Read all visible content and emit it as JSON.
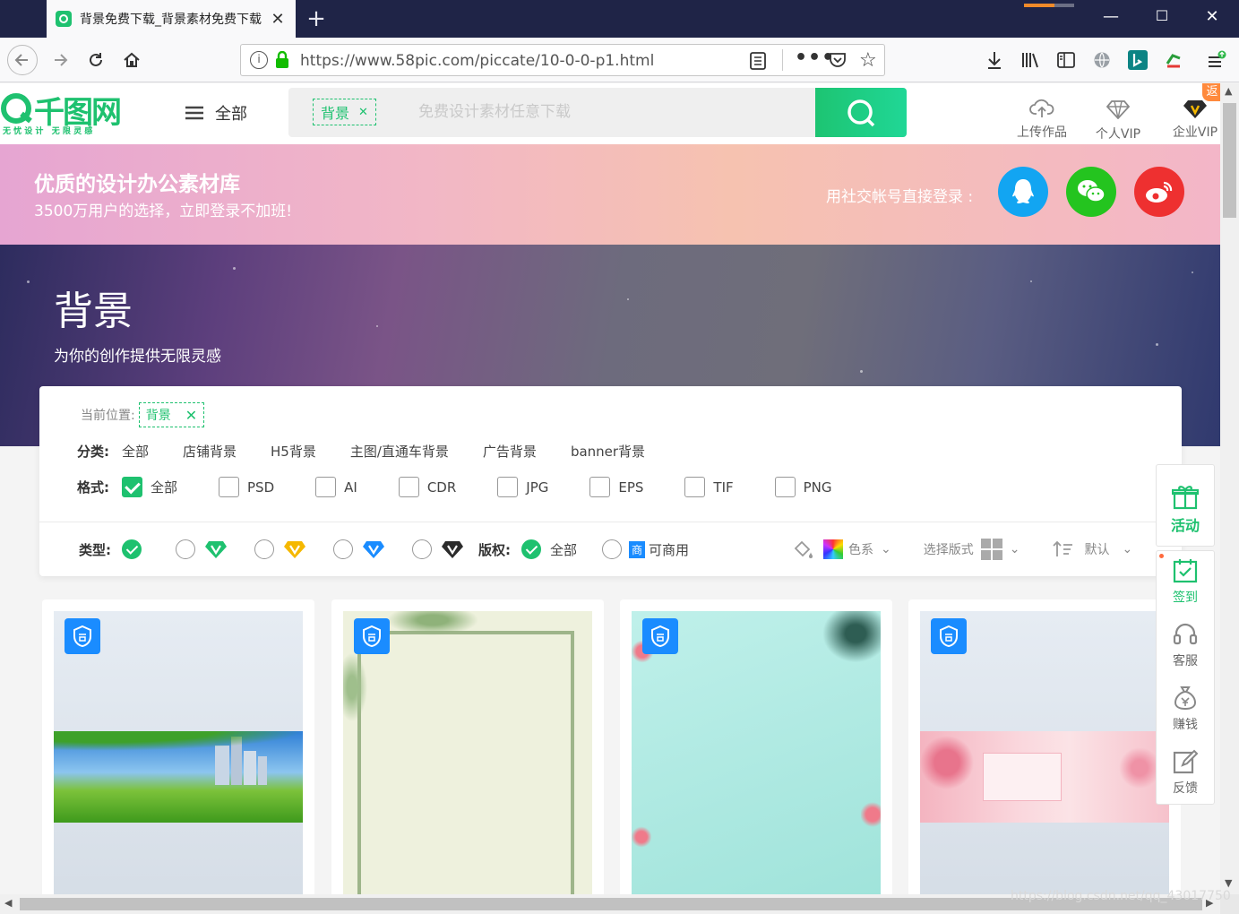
{
  "browser": {
    "tab_title": "背景免费下载_背景素材免费下载",
    "url": "https://www.58pic.com/piccate/10-0-0-p1.html"
  },
  "header": {
    "logo_text": "千图网",
    "logo_tagline": "无 忧 设 计   无 限 灵 感",
    "menu_label": "全部",
    "search_tag": "背景",
    "search_placeholder": "免费设计素材任意下载",
    "links": [
      {
        "label": "上传作品",
        "icon": "cloud-upload-icon"
      },
      {
        "label": "个人VIP",
        "icon": "diamond-icon"
      },
      {
        "label": "企业VIP",
        "icon": "enterprise-diamond-icon"
      }
    ],
    "corner_badge": "返"
  },
  "login_banner": {
    "title": "优质的设计办公素材库",
    "subtitle": "3500万用户的选择，立即登录不加班!",
    "social_label": "用社交帐号直接登录 :",
    "social": [
      {
        "name": "qq",
        "color": "#12a5f2"
      },
      {
        "name": "wechat",
        "color": "#24c41f"
      },
      {
        "name": "weibo",
        "color": "#ee3030"
      }
    ]
  },
  "hero": {
    "title": "背景",
    "subtitle": "为你的创作提供无限灵感"
  },
  "filters": {
    "breadcrumb_label": "当前位置:",
    "breadcrumb_tag": "背景",
    "category_label": "分类:",
    "categories": [
      "全部",
      "店铺背景",
      "H5背景",
      "主图/直通车背景",
      "广告背景",
      "banner背景"
    ],
    "format_label": "格式:",
    "formats": [
      {
        "label": "全部",
        "checked": true
      },
      {
        "label": "PSD",
        "checked": false
      },
      {
        "label": "AI",
        "checked": false
      },
      {
        "label": "CDR",
        "checked": false
      },
      {
        "label": "JPG",
        "checked": false
      },
      {
        "label": "EPS",
        "checked": false
      },
      {
        "label": "TIF",
        "checked": false
      },
      {
        "label": "PNG",
        "checked": false
      }
    ],
    "type_label": "类型:",
    "copyright_label": "版权:",
    "copyright_all": "全部",
    "copyright_commercial": "可商用",
    "commercial_badge": "商",
    "color_label": "色系",
    "layout_label": "选择版式",
    "sort_label": "默认"
  },
  "cards": [
    {
      "name": "city-grassland"
    },
    {
      "name": "leaf-frame"
    },
    {
      "name": "teal-tropical"
    },
    {
      "name": "pink-rose"
    }
  ],
  "side_float": [
    {
      "label": "活动",
      "icon": "gift-icon"
    },
    {
      "label": "签到",
      "icon": "calendar-check-icon"
    },
    {
      "label": "客服",
      "icon": "headset-icon"
    },
    {
      "label": "赚钱",
      "icon": "money-bag-icon"
    },
    {
      "label": "反馈",
      "icon": "edit-icon"
    }
  ],
  "watermark": "https://blog.csdn.net/qq_43017750",
  "colors": {
    "brand": "#1ec16f",
    "commercial": "#1a8cff"
  }
}
